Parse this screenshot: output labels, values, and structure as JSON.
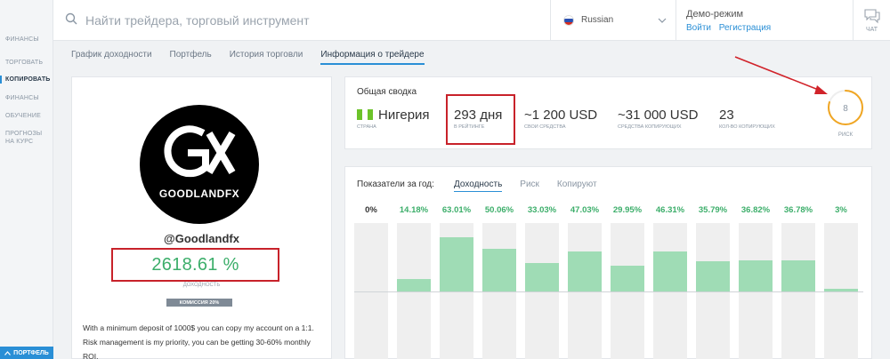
{
  "sidebar": {
    "items": [
      {
        "label": "ФИНАНСЫ",
        "active": false
      },
      {
        "label": "ТОРГОВАТЬ",
        "active": false
      },
      {
        "label": "КОПИРОВАТЬ",
        "active": true
      },
      {
        "label": "ФИНАНСЫ",
        "active": false
      },
      {
        "label": "ОБУЧЕНИЕ",
        "active": false
      },
      {
        "label": "ПРОГНОЗЫ НА КУРС",
        "active": false
      }
    ],
    "portfolio_button": "ПОРТФЕЛЬ"
  },
  "header": {
    "search_placeholder": "Найти трейдера, торговый инструмент",
    "language": "Russian",
    "demo_title": "Демо-режим",
    "login_link": "Войти",
    "register_link": "Регистрация",
    "chat_label": "ЧАТ"
  },
  "tabs": [
    {
      "label": "График доходности",
      "active": false
    },
    {
      "label": "Портфель",
      "active": false
    },
    {
      "label": "История торговли",
      "active": false
    },
    {
      "label": "Информация о трейдере",
      "active": true
    }
  ],
  "profile": {
    "logo_text": "GOODLANDFX",
    "username": "@Goodlandfx",
    "profit": "2618.61 %",
    "profit_label": "ДОХОДНОСТЬ",
    "commission": "КОМИССИЯ 20%",
    "description": "With a minimum deposit of 1000$ you can copy my account on a 1:1. Risk management is my priority, you can be getting 30-60% monthly ROI."
  },
  "summary": {
    "title": "Общая сводка",
    "country": "Нигерия",
    "country_label": "СТРАНА",
    "rating_days": "293 дня",
    "rating_label": "В РЕЙТИНГЕ",
    "own_funds": "~1 200 USD",
    "own_funds_label": "СВОИ СРЕДСТВА",
    "copier_funds": "~31 000 USD",
    "copier_funds_label": "СРЕДСТВА КОПИРУЮЩИХ",
    "copiers": "23",
    "copiers_label": "КОЛ-ВО КОПИРУЮЩИХ",
    "risk": "8",
    "risk_label": "РИСК",
    "risk_max": 10
  },
  "indicators": {
    "title": "Показатели за год:",
    "tabs": [
      {
        "label": "Доходность",
        "active": true
      },
      {
        "label": "Риск",
        "active": false
      },
      {
        "label": "Копируют",
        "active": false
      }
    ]
  },
  "colors": {
    "accent": "#2a8fd6",
    "positive": "#3cae6a",
    "bar_fill": "#9fdcb5",
    "highlight": "#c8222a",
    "risk_ring": "#f0a623"
  },
  "chart_data": {
    "type": "bar",
    "labels": [
      "0%",
      "14.18%",
      "63.01%",
      "50.06%",
      "33.03%",
      "47.03%",
      "29.95%",
      "46.31%",
      "35.79%",
      "36.82%",
      "36.78%",
      "3%"
    ],
    "values": [
      0,
      14.18,
      63.01,
      50.06,
      33.03,
      47.03,
      29.95,
      46.31,
      35.79,
      36.82,
      36.78,
      3
    ],
    "ylim": [
      -80,
      80
    ]
  }
}
